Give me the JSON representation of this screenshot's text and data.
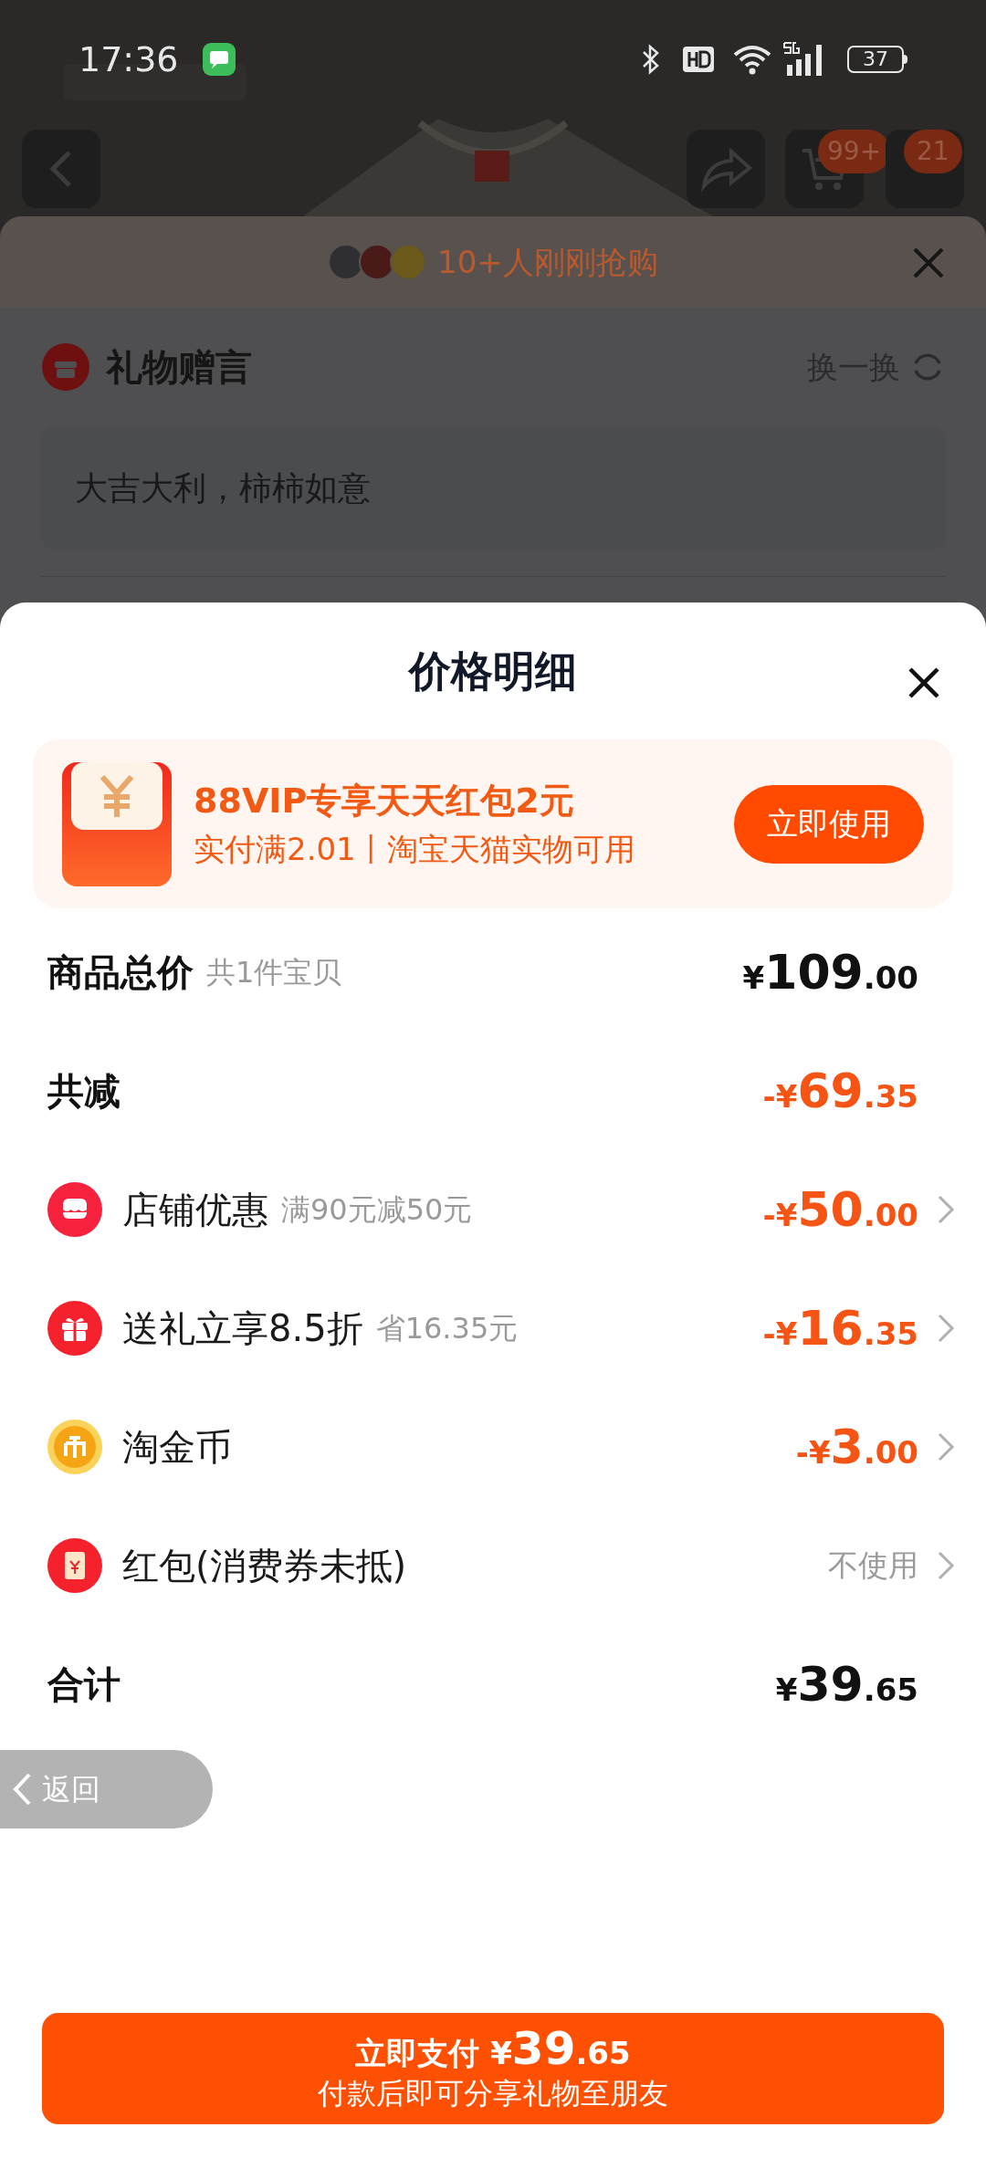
{
  "status_bar": {
    "time": "17:36",
    "battery": "37"
  },
  "background_page": {
    "cart_badge": "99+",
    "more_badge": "21",
    "social_proof": "10+人刚刚抢购",
    "gift_message": {
      "title": "礼物赠言",
      "refresh": "换一换",
      "text": "大吉大利，柿柿如意"
    }
  },
  "sheet": {
    "title": "价格明细",
    "promo": {
      "title": "88VIP专享天天红包2元",
      "subtitle": "实付满2.01丨淘宝天猫实物可用",
      "button": "立即使用"
    },
    "rows": [
      {
        "kind": "summary",
        "label": "商品总价",
        "note": "共1件宝贝",
        "value": "¥109.00",
        "highlighted": false
      },
      {
        "kind": "summary",
        "label": "共减",
        "value": "-¥69.35",
        "highlighted": true
      },
      {
        "kind": "shop",
        "label": "店铺优惠",
        "note": "满90元减50元",
        "value": "-¥50.00",
        "highlighted": true
      },
      {
        "kind": "gift",
        "label": "送礼立享8.5折",
        "note": "省16.35元",
        "value": "-¥16.35",
        "highlighted": true
      },
      {
        "kind": "coin",
        "label": "淘金币",
        "value": "-¥3.00",
        "highlighted": true
      },
      {
        "kind": "envelope",
        "label": "红包(消费券未抵)",
        "value": "不使用",
        "highlighted": false
      },
      {
        "kind": "summary",
        "label": "合计",
        "value": "¥39.65",
        "highlighted": false
      }
    ],
    "back_button": "返回",
    "pay_button": {
      "label": "立即支付",
      "amount": "¥39.65",
      "subtitle": "付款后即可分享礼物至朋友"
    }
  }
}
